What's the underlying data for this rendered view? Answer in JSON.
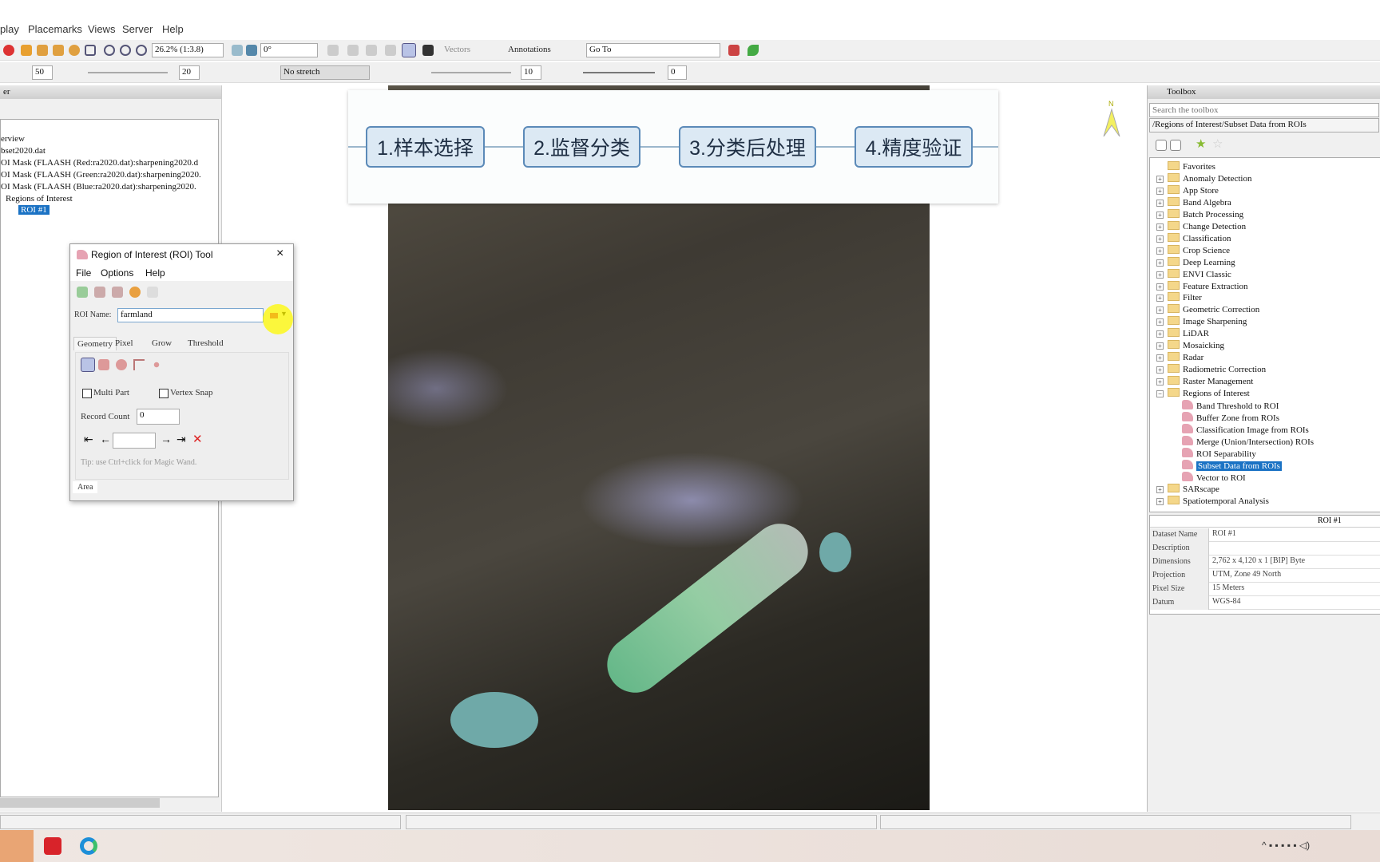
{
  "menu": [
    "play",
    "Placemarks",
    "Views",
    "Server",
    "Help"
  ],
  "toolbar": {
    "zoom": "26.2% (1:3.8)",
    "rotation": "0°",
    "vectors": "Vectors",
    "annotations": "Annotations",
    "goto": "Go To",
    "brightness": "50",
    "contrast": "20",
    "stretch": "No stretch",
    "sharpen": "10",
    "transparency": "0"
  },
  "layer_manager": {
    "header": "er",
    "items": [
      "erview",
      "bset2020.dat",
      "OI Mask (FLAASH (Red:ra2020.dat):sharpening2020.d",
      "OI Mask (FLAASH (Green:ra2020.dat):sharpening2020.",
      "OI Mask (FLAASH (Blue:ra2020.dat):sharpening2020.",
      "Regions of Interest"
    ],
    "selected": "ROI #1"
  },
  "banner": {
    "steps": [
      "1.样本选择",
      "2.监督分类",
      "3.分类后处理",
      "4.精度验证"
    ]
  },
  "roi_tool": {
    "title": "Region of Interest (ROI) Tool",
    "menu": [
      "File",
      "Options",
      "Help"
    ],
    "name_label": "ROI Name:",
    "name_value": "farmland",
    "color": "#d0006a",
    "tabs": [
      "Geometry",
      "Pixel",
      "Grow",
      "Threshold"
    ],
    "multi_part": "Multi Part",
    "vertex_snap": "Vertex Snap",
    "record_count_label": "Record Count",
    "record_count": "0",
    "tip": "Tip: use Ctrl+click for Magic Wand.",
    "bottom_tab": "Area"
  },
  "toolbox": {
    "header": "Toolbox",
    "search_placeholder": "Search the toolbox",
    "path": "/Regions of Interest/Subset Data from ROIs",
    "folders": [
      "Favorites",
      "Anomaly Detection",
      "App Store",
      "Band Algebra",
      "Batch Processing",
      "Change Detection",
      "Classification",
      "Crop Science",
      "Deep Learning",
      "ENVI Classic",
      "Feature Extraction",
      "Filter",
      "Geometric Correction",
      "Image Sharpening",
      "LiDAR",
      "Mosaicking",
      "Radar",
      "Radiometric Correction",
      "Raster Management",
      "Regions of Interest"
    ],
    "roi_tools": [
      "Band Threshold to ROI",
      "Buffer Zone from ROIs",
      "Classification Image from ROIs",
      "Merge (Union/Intersection) ROIs",
      "ROI Separability",
      "Subset Data from ROIs",
      "Vector to ROI"
    ],
    "selected": "Subset Data from ROIs",
    "after": [
      "SARscape",
      "Spatiotemporal Analysis"
    ]
  },
  "info": {
    "header": "ROI #1",
    "rows": [
      [
        "Dataset Name",
        "ROI #1"
      ],
      [
        "Description",
        ""
      ],
      [
        "Dimensions",
        "2,762 x 4,120 x 1 [BIP] Byte"
      ],
      [
        "Projection",
        "UTM, Zone 49 North"
      ],
      [
        "Pixel Size",
        "15 Meters"
      ],
      [
        "Datum",
        "WGS-84"
      ]
    ]
  },
  "north_label": "N"
}
